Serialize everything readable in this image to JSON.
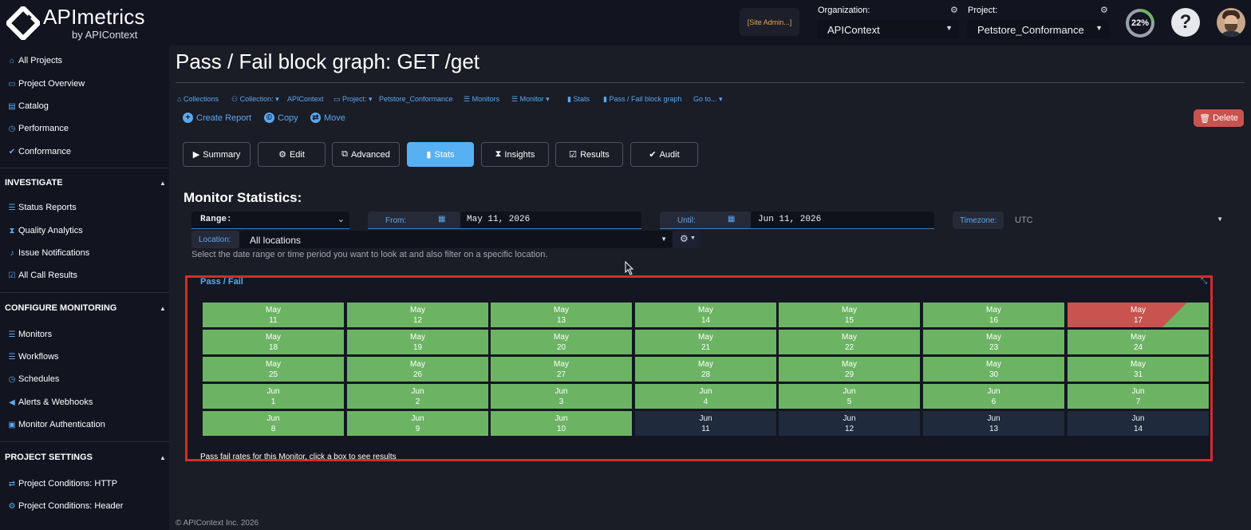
{
  "header": {
    "brand": "APImetrics",
    "brand_sub": "by APIContext",
    "site_admin": "[Site Admin...]",
    "org_label": "Organization:",
    "org_value": "APIContext",
    "project_label": "Project:",
    "project_value": "Petstore_Conformance",
    "progress_text": "22%",
    "progress_value": 22,
    "help_icon": "question-icon",
    "accent": "#5aa9ef"
  },
  "sidebar": {
    "top_items": [
      {
        "label": "All Projects",
        "icon": "home-icon"
      },
      {
        "label": "Project Overview",
        "icon": "folder-icon"
      },
      {
        "label": "Catalog",
        "icon": "book-icon"
      },
      {
        "label": "Performance",
        "icon": "clock-icon"
      },
      {
        "label": "Conformance",
        "icon": "check-icon"
      }
    ],
    "investigate": {
      "title": "INVESTIGATE",
      "items": [
        {
          "label": "Status Reports",
          "icon": "list-icon"
        },
        {
          "label": "Quality Analytics",
          "icon": "hourglass-icon"
        },
        {
          "label": "Issue Notifications",
          "icon": "bell-icon"
        },
        {
          "label": "All Call Results",
          "icon": "check-square-icon"
        }
      ]
    },
    "configure": {
      "title": "CONFIGURE MONITORING",
      "items": [
        {
          "label": "Monitors",
          "icon": "list-icon"
        },
        {
          "label": "Workflows",
          "icon": "list-icon"
        },
        {
          "label": "Schedules",
          "icon": "clock-icon"
        },
        {
          "label": "Alerts & Webhooks",
          "icon": "bullhorn-icon"
        },
        {
          "label": "Monitor Authentication",
          "icon": "lock-icon"
        }
      ]
    },
    "settings": {
      "title": "PROJECT SETTINGS",
      "items": [
        {
          "label": "Project Conditions: HTTP",
          "icon": "exchange-icon"
        },
        {
          "label": "Project Conditions: Header",
          "icon": "gear-icon"
        }
      ]
    }
  },
  "main": {
    "title": "Pass / Fail block graph: GET /get",
    "breadcrumbs": {
      "collections": "Collections",
      "collection": "Collection:",
      "collection_value": "APIContext",
      "project": "Project:",
      "project_value": "Petstore_Conformance",
      "monitors": "Monitors",
      "monitor": "Monitor",
      "stats": "Stats",
      "passfail": "Pass / Fail block graph",
      "goto": "Go to..."
    },
    "actions": {
      "create_report": "Create Report",
      "copy": "Copy",
      "move": "Move",
      "delete": "Delete"
    },
    "tabs": [
      {
        "label": "Summary",
        "icon": "play-icon"
      },
      {
        "label": "Edit",
        "icon": "gear-icon"
      },
      {
        "label": "Advanced",
        "icon": "tags-icon"
      },
      {
        "label": "Stats",
        "icon": "bar-chart-icon",
        "active": true
      },
      {
        "label": "Insights",
        "icon": "hourglass-icon"
      },
      {
        "label": "Results",
        "icon": "check-square-icon"
      },
      {
        "label": "Audit",
        "icon": "check-icon"
      }
    ],
    "stats_title": "Monitor Statistics:",
    "filters": {
      "range_label": "Range:",
      "from_label": "From:",
      "from_value": "May 11, 2026",
      "until_label": "Until:",
      "until_value": "Jun 11, 2026",
      "timezone_label": "Timezone:",
      "timezone_value": "UTC",
      "location_label": "Location:",
      "location_value": "All locations",
      "hint": "Select the date range or time period you want to look at and also filter on a specific location."
    },
    "passfail": {
      "title": "Pass / Fail",
      "footer": "Pass fail rates for this Monitor, click a box to see results",
      "colors": {
        "pass": "#6cb464",
        "fail": "#c9534f",
        "no_data": "#1f2a3d"
      },
      "weeks": [
        [
          {
            "month": "May",
            "day": "11",
            "status": "pass"
          },
          {
            "month": "May",
            "day": "12",
            "status": "pass"
          },
          {
            "month": "May",
            "day": "13",
            "status": "pass"
          },
          {
            "month": "May",
            "day": "14",
            "status": "pass"
          },
          {
            "month": "May",
            "day": "15",
            "status": "pass"
          },
          {
            "month": "May",
            "day": "16",
            "status": "pass"
          },
          {
            "month": "May",
            "day": "17",
            "status": "mixed"
          }
        ],
        [
          {
            "month": "May",
            "day": "18",
            "status": "pass"
          },
          {
            "month": "May",
            "day": "19",
            "status": "pass"
          },
          {
            "month": "May",
            "day": "20",
            "status": "pass"
          },
          {
            "month": "May",
            "day": "21",
            "status": "pass"
          },
          {
            "month": "May",
            "day": "22",
            "status": "pass"
          },
          {
            "month": "May",
            "day": "23",
            "status": "pass"
          },
          {
            "month": "May",
            "day": "24",
            "status": "pass"
          }
        ],
        [
          {
            "month": "May",
            "day": "25",
            "status": "pass"
          },
          {
            "month": "May",
            "day": "26",
            "status": "pass"
          },
          {
            "month": "May",
            "day": "27",
            "status": "pass"
          },
          {
            "month": "May",
            "day": "28",
            "status": "pass"
          },
          {
            "month": "May",
            "day": "29",
            "status": "pass"
          },
          {
            "month": "May",
            "day": "30",
            "status": "pass"
          },
          {
            "month": "May",
            "day": "31",
            "status": "pass"
          }
        ],
        [
          {
            "month": "Jun",
            "day": "1",
            "status": "pass"
          },
          {
            "month": "Jun",
            "day": "2",
            "status": "pass"
          },
          {
            "month": "Jun",
            "day": "3",
            "status": "pass"
          },
          {
            "month": "Jun",
            "day": "4",
            "status": "pass"
          },
          {
            "month": "Jun",
            "day": "5",
            "status": "pass"
          },
          {
            "month": "Jun",
            "day": "6",
            "status": "pass"
          },
          {
            "month": "Jun",
            "day": "7",
            "status": "pass"
          }
        ],
        [
          {
            "month": "Jun",
            "day": "8",
            "status": "pass"
          },
          {
            "month": "Jun",
            "day": "9",
            "status": "pass"
          },
          {
            "month": "Jun",
            "day": "10",
            "status": "pass"
          },
          {
            "month": "Jun",
            "day": "11",
            "status": "future"
          },
          {
            "month": "Jun",
            "day": "12",
            "status": "future"
          },
          {
            "month": "Jun",
            "day": "13",
            "status": "future"
          },
          {
            "month": "Jun",
            "day": "14",
            "status": "future"
          }
        ]
      ]
    },
    "copyright": "© APIContext Inc. 2026"
  }
}
